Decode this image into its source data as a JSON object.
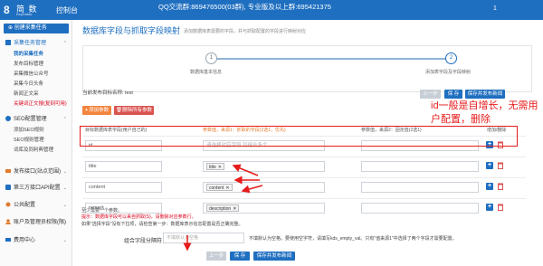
{
  "header": {
    "logo_glyph": "8",
    "logo_text": "简 数",
    "logo_sub": "KeyDatas",
    "app_title": "控制台",
    "notice": "QQ交流群:869476500(03群),                              专业版及以上群:695421375",
    "user": "1"
  },
  "sidebar": {
    "create_button": "创建采集任务",
    "sections": [
      {
        "label": "采集任务管理",
        "icon": "list-icon",
        "color": "#1f6fc0"
      },
      {
        "label": "SEO配置管理",
        "icon": "settings-icon",
        "color": "#1f6fc0"
      },
      {
        "label": "发布接口(站点范围)",
        "icon": "publish-icon",
        "color": "#e07b2e"
      },
      {
        "label": "第三方接口API配置",
        "icon": "api-icon",
        "color": "#1f6fc0"
      },
      {
        "label": "公共配置",
        "icon": "config-icon",
        "color": "#e07b2e"
      },
      {
        "label": "账户及管理员权限(限)",
        "icon": "user-icon",
        "color": "#e07b2e"
      },
      {
        "label": "费用中心",
        "icon": "wallet-icon",
        "color": "#1f6fc0"
      }
    ],
    "task_items": [
      "我的采集任务",
      "发布目标管理",
      "采集微信公众号",
      "采集今日头条",
      "新闻正文采",
      "关键词正文搜(复刻可用)"
    ],
    "seo_items": [
      "添加SEO规则",
      "SEO规则管理",
      "词库及同利典管理"
    ]
  },
  "main": {
    "title": "数据库字段与抓取字段映射",
    "subtitle": "添加数据库表需要的字段，并与抓取配置的字段进行映射对应",
    "steps": [
      {
        "number": "1",
        "label": "数据库基本信息"
      },
      {
        "number": "2",
        "label": "添加表字段及字段映射"
      }
    ],
    "current_task": "当前发布目标名称:  test",
    "buttons": {
      "prev": "上一步",
      "save": "保 存",
      "save_publish": "保存并发布新闻",
      "add_param": "添加参数",
      "delete_all": "删除所有参数"
    },
    "columns": {
      "db_field": "目标数据库表字段(用户自己的)",
      "param1": "参数值，来源1：抓取的字段(2选1，优先)",
      "param2": "参数值，来源2：固定值(2选1)",
      "ops": "增加/删除"
    },
    "rows": [
      {
        "field": "id",
        "source_placeholder": "请选择对应字段,可组合多个",
        "source_tag": "",
        "fixed": ""
      },
      {
        "field": "title",
        "source_placeholder": "",
        "source_tag": "title",
        "fixed": ""
      },
      {
        "field": "content",
        "source_placeholder": "",
        "source_tag": "content",
        "fixed": ""
      },
      {
        "field": "remark",
        "source_placeholder": "",
        "source_tag": "description",
        "fixed": ""
      }
    ],
    "notes": {
      "note1": "至少需要一个参数。",
      "note2": "提示：数据库字段可以来自抓取(S)，请删除对应参数行。",
      "note3": "如果\"选择字段\"没有下拉项，请检查第一步：数据库表示信息配置是否正确完整。"
    },
    "separator": {
      "label": "组合字段分隔符",
      "placeholder": "不填默认为空格",
      "hint": "不填默认为空格。要使用空字符，请填写kds_empty_val。只有\"值来源1\"中选择了两个字段才需要配置。"
    },
    "annotation": "id一般是自增长，无需用户配置，删除"
  }
}
